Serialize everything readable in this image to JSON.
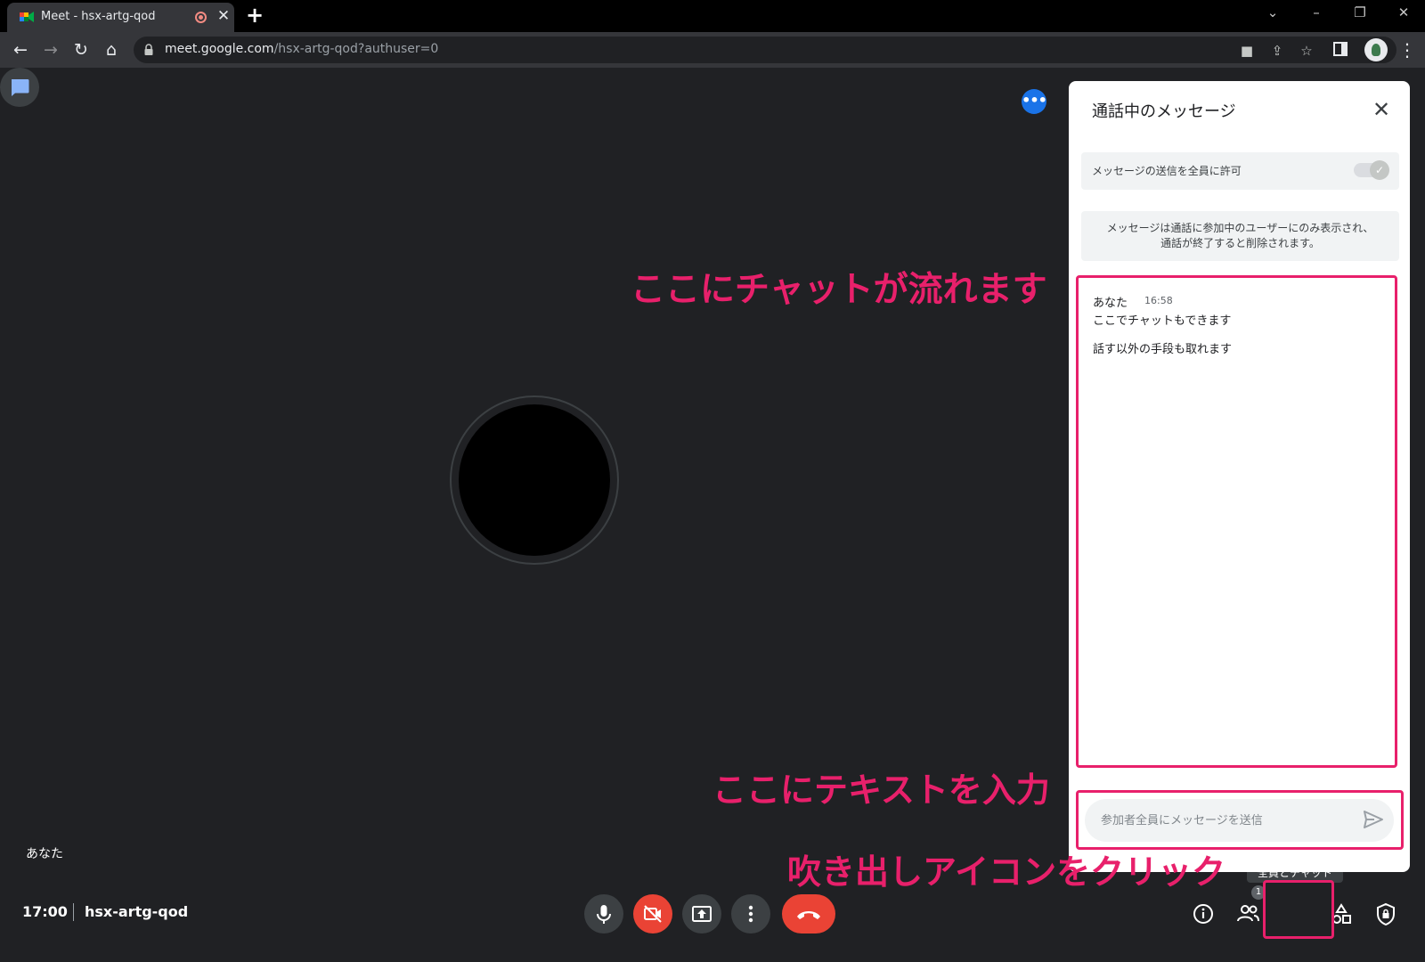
{
  "browser": {
    "tab_title": "Meet - hsx-artg-qod",
    "url_host": "meet.google.com",
    "url_path": "/hsx-artg-qod?authuser=0",
    "icons": [
      "meet-favicon",
      "recording-icon",
      "close-icon",
      "plus-icon",
      "back-icon",
      "forward-icon",
      "reload-icon",
      "home-icon",
      "lock-icon",
      "camera-icon",
      "share-icon",
      "star-icon",
      "side-panel-icon",
      "profile-avatar",
      "kebab-menu-icon"
    ]
  },
  "meet": {
    "self_name": "あなた",
    "time": "17:00",
    "meeting_code": "hsx-artg-qod",
    "people_count": "1",
    "chat_tooltip": "全員とチャット"
  },
  "chat_panel": {
    "title": "通話中のメッセージ",
    "allow_label": "メッセージの送信を全員に許可",
    "notice_line1": "メッセージは通話に参加中のユーザーにのみ表示され、",
    "notice_line2": "通話が終了すると削除されます。",
    "messages": [
      {
        "sender": "あなた",
        "time": "16:58",
        "lines": [
          "ここでチャットもできます",
          "話す以外の手段も取れます"
        ]
      }
    ],
    "input_placeholder": "参加者全員にメッセージを送信"
  },
  "annotations": {
    "chat_flows": "ここにチャットが流れます",
    "enter_text": "ここにテキストを入力",
    "click_icon": "吹き出しアイコンをクリック"
  },
  "colors": {
    "annotation": "#e8206b",
    "meet_background": "#202124",
    "hangup_red": "#ea4335",
    "accent_blue": "#1a73e8"
  }
}
